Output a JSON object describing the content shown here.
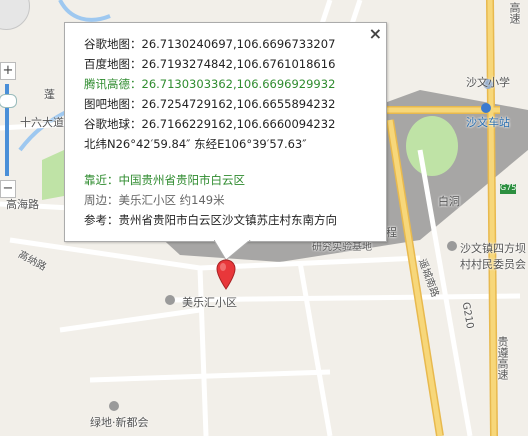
{
  "map": {
    "labels": {
      "shawen_primary": "沙文小学",
      "shawen_station": "沙文车站",
      "baidong": "白洞",
      "cheng": "程",
      "research_base": "研究实验基地",
      "liuda_road": "十六大道",
      "gaohai_road": "高海路",
      "penghu": "蓬",
      "gaona_road": "高纳路",
      "yaocheng": "遥城南路",
      "shawen_village": "沙文镇四方坝",
      "village_committee": "村村民委员会",
      "g210": "G210",
      "guizun": "贵遵高速",
      "gaosu_top": "高速",
      "g75": "G75",
      "meile_community": "美乐汇小区",
      "ludi": "绿地·新都会"
    }
  },
  "zoom": {
    "plus": "+",
    "minus": "−"
  },
  "popup": {
    "close": "×",
    "google_map": "谷歌地图：26.7130240697,106.6696733207",
    "baidu_map": "百度地图：26.7193274842,106.6761018616",
    "tencent_gaode": "腾讯高德：26.7130303362,106.6696929932",
    "tuba_map": "图吧地图：26.7254729162,106.6655894232",
    "google_earth": "谷歌地球：26.7166229162,106.6660094232",
    "dms": "北纬N26°42′59.84″ 东经E106°39′57.63″",
    "near_label": "靠近：",
    "near_value": "中国贵州省贵阳市白云区",
    "around_label": "周边：",
    "around_value": "美乐汇小区 约149米",
    "ref_label": "参考：",
    "ref_value": "贵州省贵阳市白云区沙文镇苏庄村东南方向"
  },
  "colors": {
    "highway": "#f7d77a",
    "green_area": "#bfe3a6",
    "water": "#9ec8f0",
    "marker": "#e8373a"
  }
}
